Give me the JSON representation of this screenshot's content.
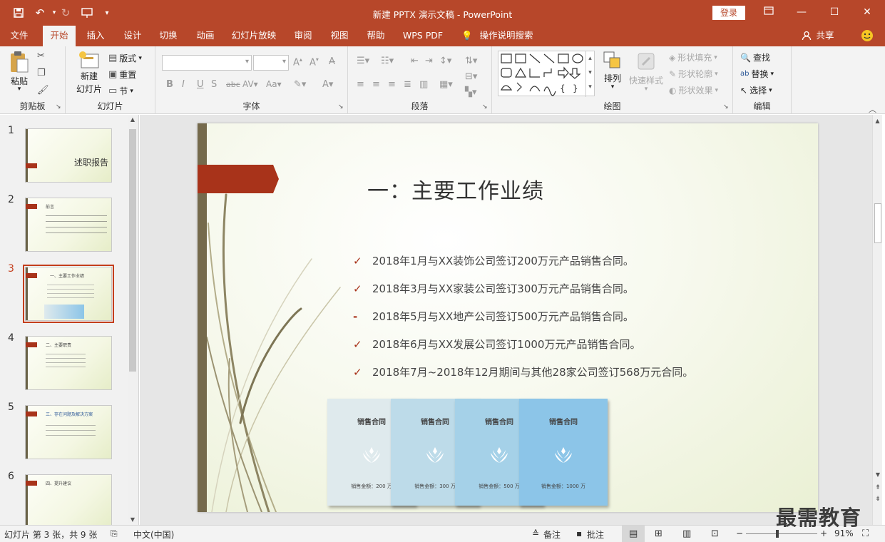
{
  "window": {
    "title": "新建 PPTX 演示文稿 - PowerPoint",
    "login_label": "登录",
    "accent": "#b7472a"
  },
  "tabs": [
    "文件",
    "开始",
    "插入",
    "设计",
    "切换",
    "动画",
    "幻灯片放映",
    "审阅",
    "视图",
    "帮助",
    "WPS PDF",
    "操作说明搜索"
  ],
  "share_label": "共享",
  "ribbon": {
    "clipboard": {
      "paste": "粘贴",
      "label": "剪贴板"
    },
    "slides": {
      "new_slide_1": "新建",
      "new_slide_2": "幻灯片",
      "layout": "版式",
      "reset": "重置",
      "section": "节",
      "label": "幻灯片"
    },
    "font": {
      "label": "字体"
    },
    "paragraph": {
      "label": "段落"
    },
    "drawing": {
      "arrange": "排列",
      "quick_styles": "快速样式",
      "shape_fill": "形状填充",
      "shape_outline": "形状轮廓",
      "shape_effects": "形状效果",
      "label": "绘图"
    },
    "editing": {
      "find": "查找",
      "replace": "替换",
      "select": "选择",
      "label": "编辑"
    }
  },
  "thumbnails": [
    {
      "num": "1",
      "text": "述职报告"
    },
    {
      "num": "2",
      "text": "前言"
    },
    {
      "num": "3",
      "text": "一、主要工作业绩"
    },
    {
      "num": "4",
      "text": "二、主要职责"
    },
    {
      "num": "5",
      "text": "三、存在问题及解决方案"
    },
    {
      "num": "6",
      "text": "四、提升建议"
    }
  ],
  "slide": {
    "title": "一：主要工作业绩",
    "bullets": [
      {
        "marker": "✓",
        "text": "2018年1月与XX装饰公司签订200万元产品销售合同。"
      },
      {
        "marker": "✓",
        "text": "2018年3月与XX家装公司签订300万元产品销售合同。"
      },
      {
        "marker": "-",
        "text": "2018年5月与XX地产公司签订500万元产品销售合同。"
      },
      {
        "marker": "✓",
        "text": "2018年6月与XX发展公司签订1000万元产品销售合同。"
      },
      {
        "marker": "✓",
        "text": "2018年7月~2018年12月期间与其他28家公司签订568万元合同。"
      }
    ],
    "cards": [
      {
        "title": "销售合同",
        "footer": "销售金额：200 万",
        "color": "#dfeaed"
      },
      {
        "title": "销售合同",
        "footer": "销售金额：300 万",
        "color": "#bddbe9"
      },
      {
        "title": "销售合同",
        "footer": "销售金额：500 万",
        "color": "#a5d1e8"
      },
      {
        "title": "销售合同",
        "footer": "销售金额：1000 万",
        "color": "#8cc5e8"
      }
    ]
  },
  "status": {
    "slide_info": "幻灯片 第 3 张，共 9 张",
    "language": "中文(中国)",
    "notes": "备注",
    "comments": "批注",
    "zoom": "91%",
    "minus": "−",
    "plus": "+"
  },
  "watermark": "最需教育"
}
